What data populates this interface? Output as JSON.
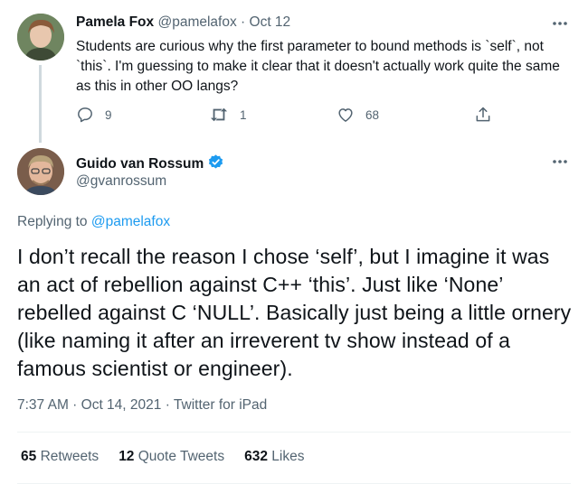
{
  "parent_tweet": {
    "name": "Pamela Fox",
    "handle": "@pamelafox",
    "separator": "·",
    "date": "Oct 12",
    "text": "Students are curious why the first parameter to bound methods is `self`, not `this`. I'm guessing to make it clear that it doesn't actually work quite the same as this in other OO langs?",
    "replies": "9",
    "retweets": "1",
    "likes": "68",
    "icons": {
      "reply": "reply-icon",
      "retweet": "retweet-icon",
      "like": "heart-icon",
      "share": "share-icon",
      "more": "more-icon"
    }
  },
  "main_tweet": {
    "name": "Guido van Rossum",
    "verified": true,
    "handle": "@gvanrossum",
    "replying_prefix": "Replying to",
    "replying_to": "@pamelafox",
    "text": "I don’t recall the reason I chose ‘self’, but I imagine it was an act of rebellion against C++ ‘this’. Just like ‘None’ rebelled against C ‘NULL’. Basically just being a little ornery (like naming it after an irreverent tv show instead of a famous scientist or engineer).",
    "meta": "7:37 AM · Oct 14, 2021 · Twitter for iPad",
    "stats": {
      "retweets_count": "65",
      "retweets_label": "Retweets",
      "quotes_count": "12",
      "quotes_label": "Quote Tweets",
      "likes_count": "632",
      "likes_label": "Likes"
    }
  },
  "colors": {
    "accent": "#1d9bf0",
    "text": "#0f1419",
    "muted": "#536471",
    "border": "#eff3f4"
  }
}
